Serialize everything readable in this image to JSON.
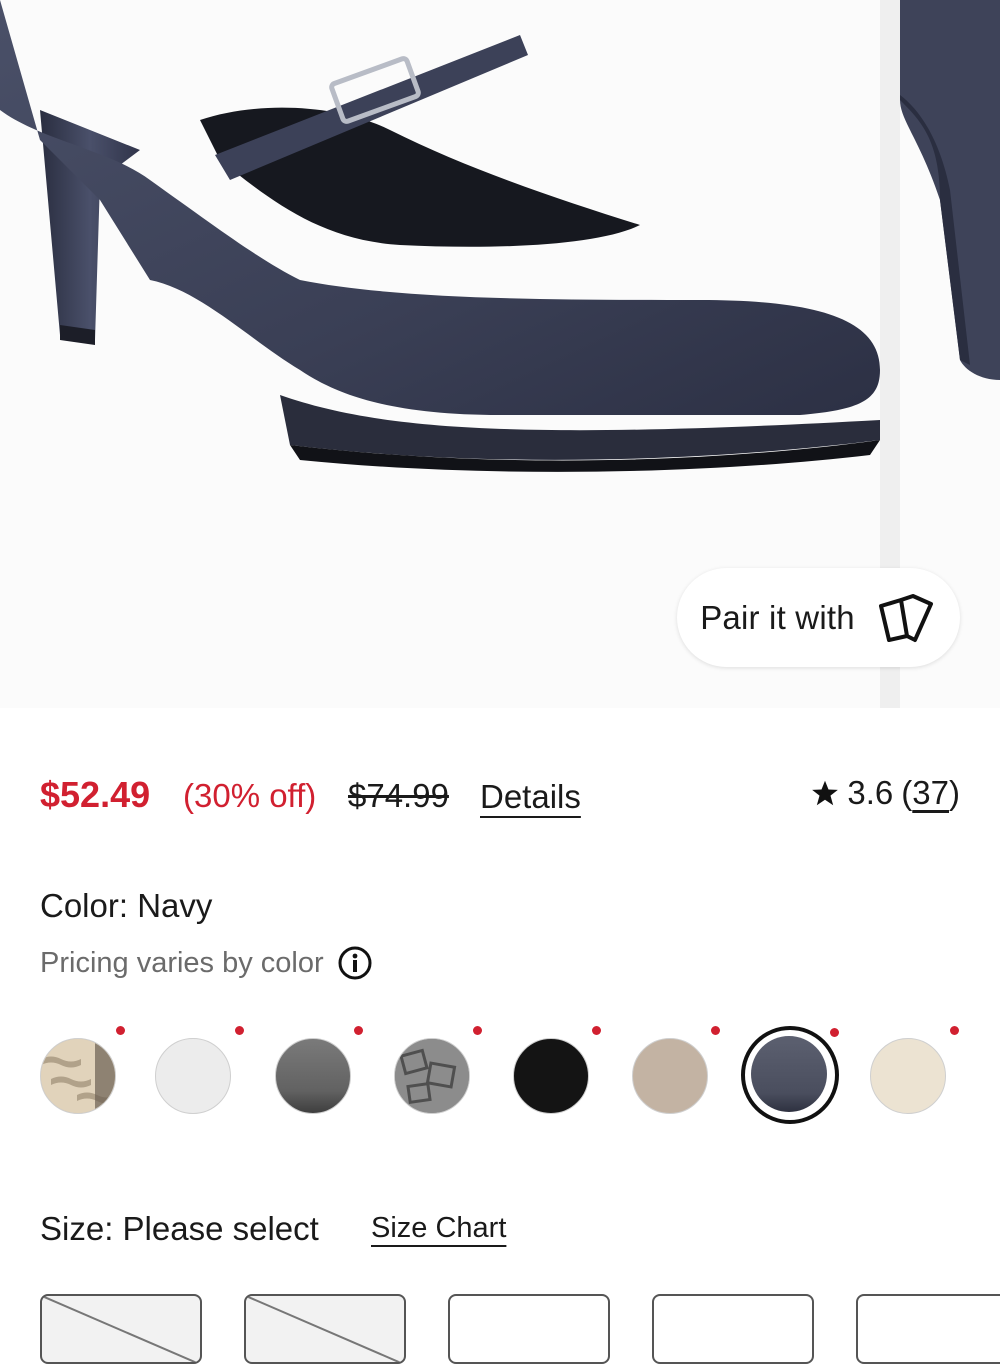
{
  "gallery": {
    "pair_label": "Pair it with",
    "pair_icon": "cards-icon"
  },
  "price": {
    "sale": "$52.49",
    "discount": "(30% off)",
    "original": "$74.99",
    "details_link": "Details",
    "sale_color": "#d12030"
  },
  "rating": {
    "value": "3.6",
    "open": "(",
    "count": "37",
    "close": ")"
  },
  "color": {
    "label": "Color: Navy",
    "pricing_note": "Pricing varies by color",
    "swatches": [
      {
        "name": "snakeskin",
        "selected": false
      },
      {
        "name": "white",
        "selected": false
      },
      {
        "name": "grey",
        "selected": false
      },
      {
        "name": "pewter-print",
        "selected": false
      },
      {
        "name": "black",
        "selected": false
      },
      {
        "name": "taupe",
        "selected": false
      },
      {
        "name": "navy",
        "selected": true
      },
      {
        "name": "cream",
        "selected": false
      }
    ]
  },
  "size": {
    "label": "Size: Please select",
    "chart_link": "Size Chart"
  }
}
